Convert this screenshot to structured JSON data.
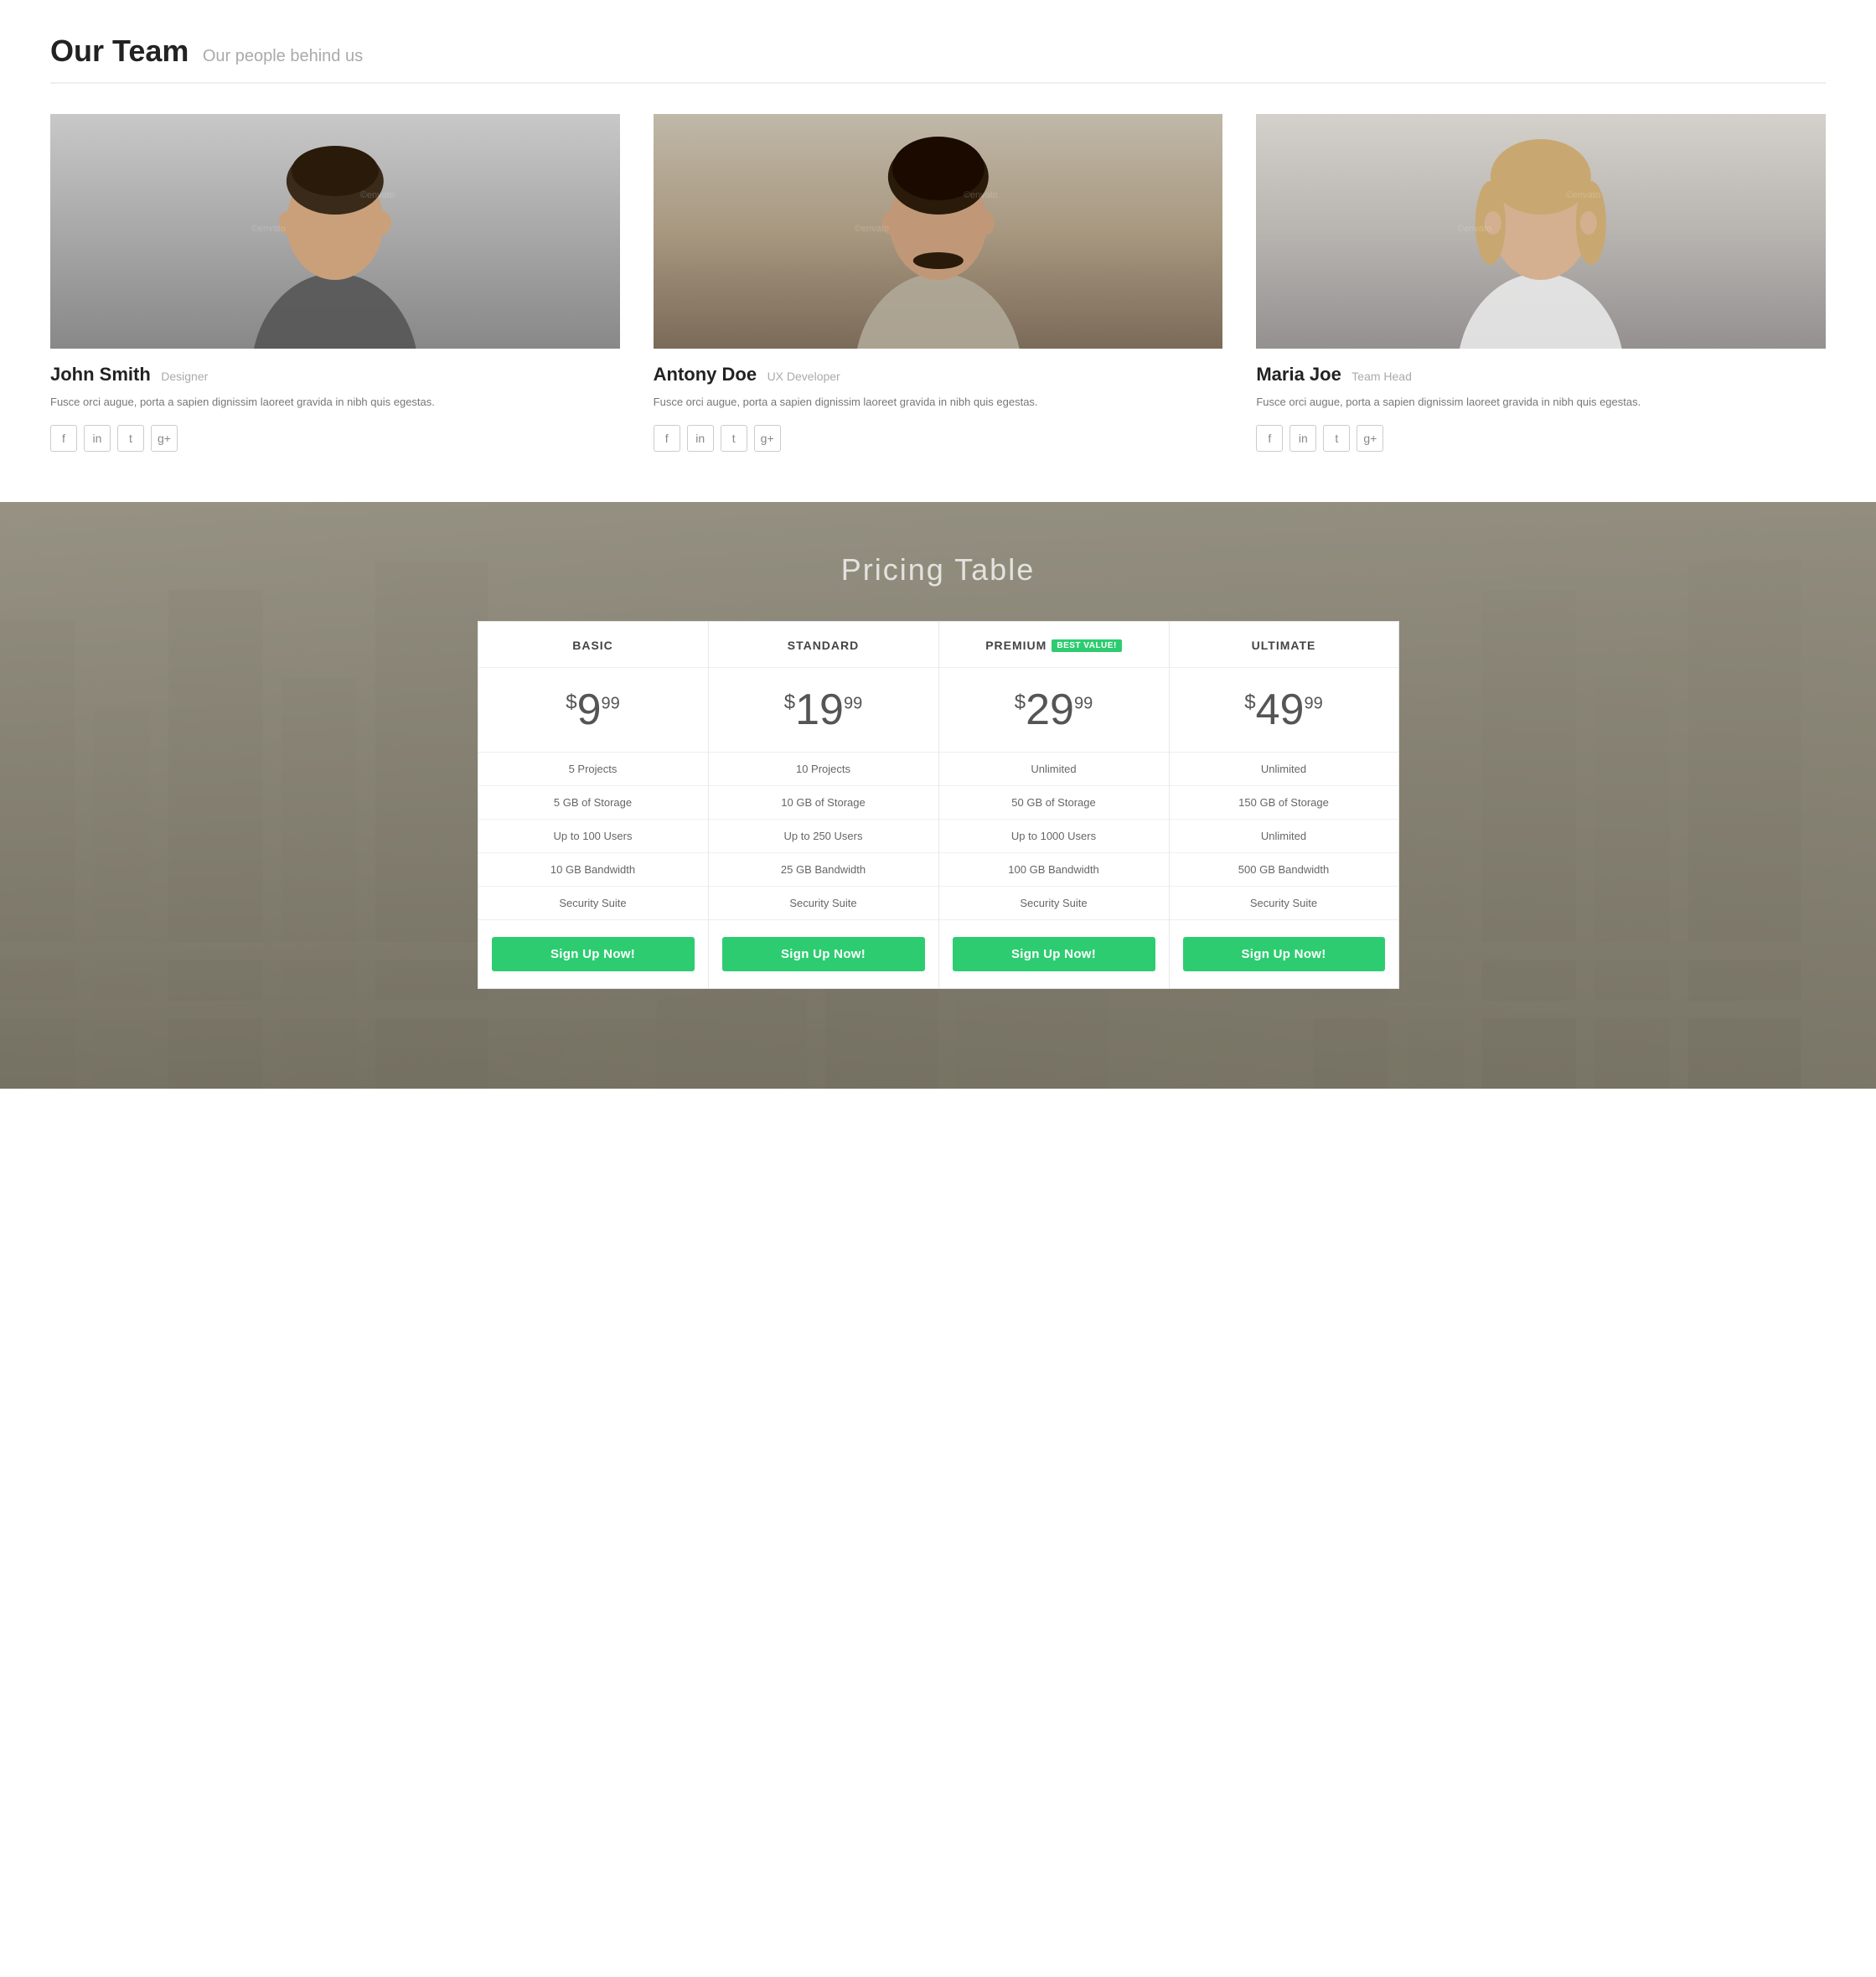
{
  "team": {
    "heading": "Our Team",
    "subtitle": "Our people behind us",
    "members": [
      {
        "id": "john",
        "name": "John Smith",
        "role": "Designer",
        "bio": "Fusce orci augue, porta a sapien dignissim laoreet gravida in nibh quis egestas.",
        "photo_color_top": "#c5c5c5",
        "photo_color_bottom": "#959595",
        "socials": [
          "facebook",
          "linkedin",
          "twitter",
          "google-plus"
        ]
      },
      {
        "id": "antony",
        "name": "Antony Doe",
        "role": "UX Developer",
        "bio": "Fusce orci augue, porta a sapien dignissim laoreet gravida in nibh quis egestas.",
        "photo_color_top": "#bdb0a0",
        "photo_color_bottom": "#8a7a68",
        "socials": [
          "facebook",
          "linkedin",
          "twitter",
          "google-plus"
        ]
      },
      {
        "id": "maria",
        "name": "Maria Joe",
        "role": "Team Head",
        "bio": "Fusce orci augue, porta a sapien dignissim laoreet gravida in nibh quis egestas.",
        "photo_color_top": "#d0ccc8",
        "photo_color_bottom": "#a0a0a0",
        "socials": [
          "facebook",
          "linkedin",
          "twitter",
          "google-plus"
        ]
      }
    ]
  },
  "pricing": {
    "section_title": "Pricing Table",
    "plans": [
      {
        "id": "basic",
        "name": "BASIC",
        "badge": null,
        "price_symbol": "$",
        "price_whole": "9",
        "price_cents": "99",
        "features": [
          "5 Projects",
          "5 GB of Storage",
          "Up to 100 Users",
          "10 GB Bandwidth",
          "Security Suite"
        ],
        "cta": "Sign Up Now!"
      },
      {
        "id": "standard",
        "name": "STANDARD",
        "badge": null,
        "price_symbol": "$",
        "price_whole": "19",
        "price_cents": "99",
        "features": [
          "10 Projects",
          "10 GB of Storage",
          "Up to 250 Users",
          "25 GB Bandwidth",
          "Security Suite"
        ],
        "cta": "Sign Up Now!"
      },
      {
        "id": "premium",
        "name": "PREMIUM",
        "badge": "BEST VALUE!",
        "price_symbol": "$",
        "price_whole": "29",
        "price_cents": "99",
        "features": [
          "Unlimited",
          "50 GB of Storage",
          "Up to 1000 Users",
          "100 GB Bandwidth",
          "Security Suite"
        ],
        "cta": "Sign Up Now!"
      },
      {
        "id": "ultimate",
        "name": "ULTIMATE",
        "badge": null,
        "price_symbol": "$",
        "price_whole": "49",
        "price_cents": "99",
        "features": [
          "Unlimited",
          "150 GB of Storage",
          "Unlimited",
          "500 GB Bandwidth",
          "Security Suite"
        ],
        "cta": "Sign Up Now!"
      }
    ]
  },
  "social_icons": {
    "facebook": "f",
    "linkedin": "in",
    "twitter": "t",
    "google-plus": "g+"
  }
}
